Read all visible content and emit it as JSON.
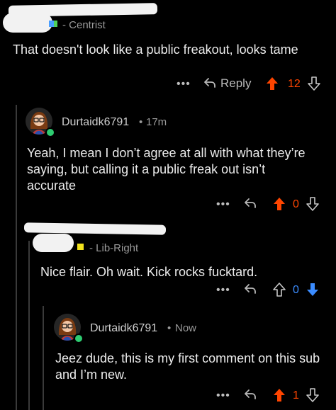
{
  "colors": {
    "background": "#000000",
    "upvote_active": "#ff4500",
    "downvote_active": "#3b8cff",
    "online": "#2ecc71",
    "thread_line": "#3a3a3a"
  },
  "comments": [
    {
      "flair": "- Centrist",
      "text": "That doesn't look like a public freakout, looks tame",
      "actions": {
        "more": "•••",
        "reply": "Reply",
        "score": "12",
        "vote_state": "upvoted"
      }
    },
    {
      "user": "Durtaidk6791",
      "separator": "•",
      "time": "17m",
      "text": "Yeah, I mean I don’t agree at all with what they’re saying, but calling it a public freak out isn’t accurate",
      "actions": {
        "more": "•••",
        "score": "0",
        "vote_state": "upvoted"
      }
    },
    {
      "flair": "- Lib-Right",
      "text": "Nice flair. Oh wait. Kick rocks fucktard.",
      "actions": {
        "more": "•••",
        "score": "0",
        "vote_state": "downvoted"
      }
    },
    {
      "user": "Durtaidk6791",
      "separator": "•",
      "time": "Now",
      "text": "Jeez dude, this is my first comment on this sub and I’m new.",
      "actions": {
        "more": "•••",
        "score": "1",
        "vote_state": "upvoted"
      }
    }
  ]
}
